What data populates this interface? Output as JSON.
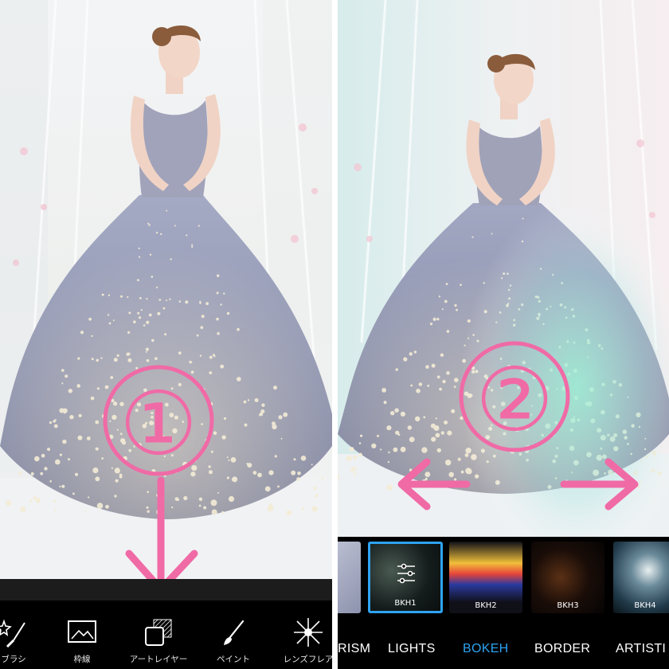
{
  "left_editor": {
    "annotation_marker": "①",
    "toolbar": [
      {
        "label": "ブラシ",
        "icon": "brush-sparkle-icon"
      },
      {
        "label": "枠線",
        "icon": "frame-picture-icon"
      },
      {
        "label": "アートレイヤー",
        "icon": "art-layer-icon"
      },
      {
        "label": "ペイント",
        "icon": "paintbrush-icon"
      },
      {
        "label": "レンズフレア",
        "icon": "lens-flare-icon"
      }
    ]
  },
  "right_editor": {
    "annotation_marker": "②",
    "thumbnails": [
      {
        "label": "",
        "selected": false
      },
      {
        "label": "BKH1",
        "selected": true
      },
      {
        "label": "BKH2",
        "selected": false
      },
      {
        "label": "BKH3",
        "selected": false
      },
      {
        "label": "BKH4",
        "selected": false
      }
    ],
    "categories": [
      {
        "label": "RISM",
        "active": false
      },
      {
        "label": "LIGHTS",
        "active": false
      },
      {
        "label": "BOKEH",
        "active": true
      },
      {
        "label": "BORDER",
        "active": false
      },
      {
        "label": "ARTISTI",
        "active": false
      }
    ]
  },
  "colors": {
    "annotation_pink": "#f06aa6",
    "active_blue": "#2ea3f2",
    "toolbar_bg": "#000000"
  }
}
